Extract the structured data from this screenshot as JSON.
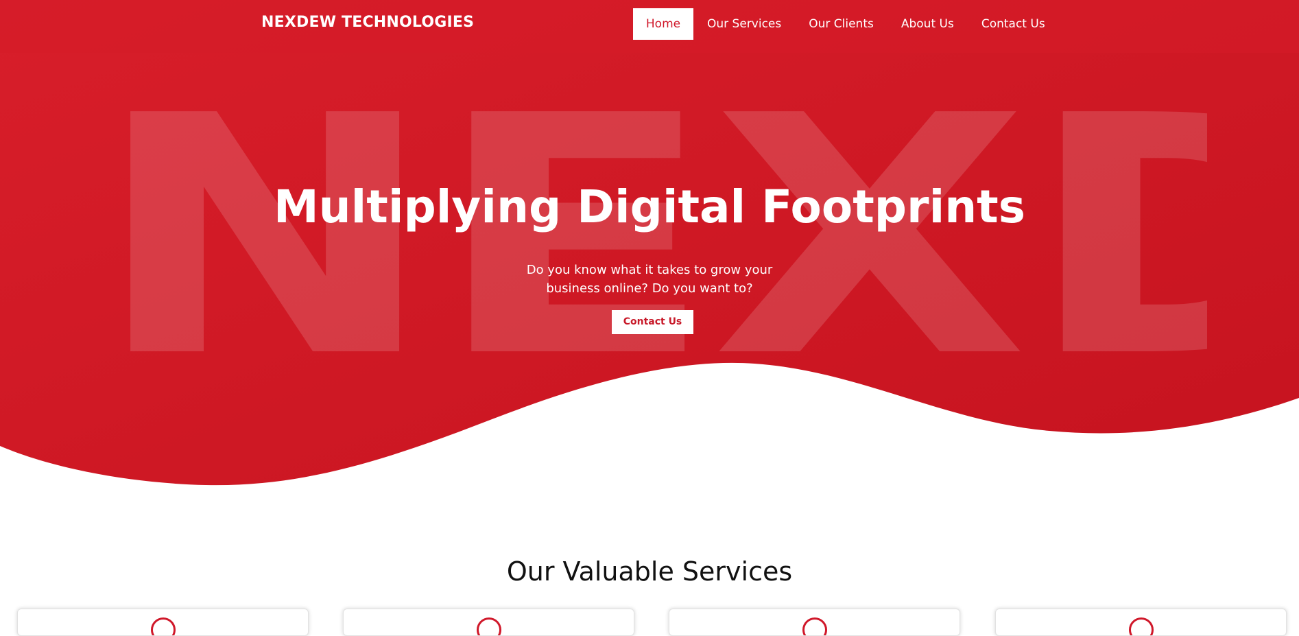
{
  "colors": {
    "brand_red": "#d0182a",
    "white": "#ffffff",
    "heading_dark": "#111111"
  },
  "header": {
    "brand": "NEXDEW TECHNOLOGIES",
    "nav": [
      {
        "label": "Home",
        "active": true
      },
      {
        "label": "Our Services",
        "active": false
      },
      {
        "label": "Our Clients",
        "active": false
      },
      {
        "label": "About Us",
        "active": false
      },
      {
        "label": "Contact Us",
        "active": false
      }
    ]
  },
  "hero": {
    "watermark": "NEXDEW",
    "title": "Multiplying Digital Footprints",
    "subtitle": "Do you know what it takes to grow your business online? Do you want to?",
    "cta_label": "Contact Us"
  },
  "services": {
    "title": "Our Valuable Services",
    "cards": [
      {
        "icon": "service-icon"
      },
      {
        "icon": "service-icon"
      },
      {
        "icon": "service-icon"
      },
      {
        "icon": "service-icon"
      }
    ]
  }
}
